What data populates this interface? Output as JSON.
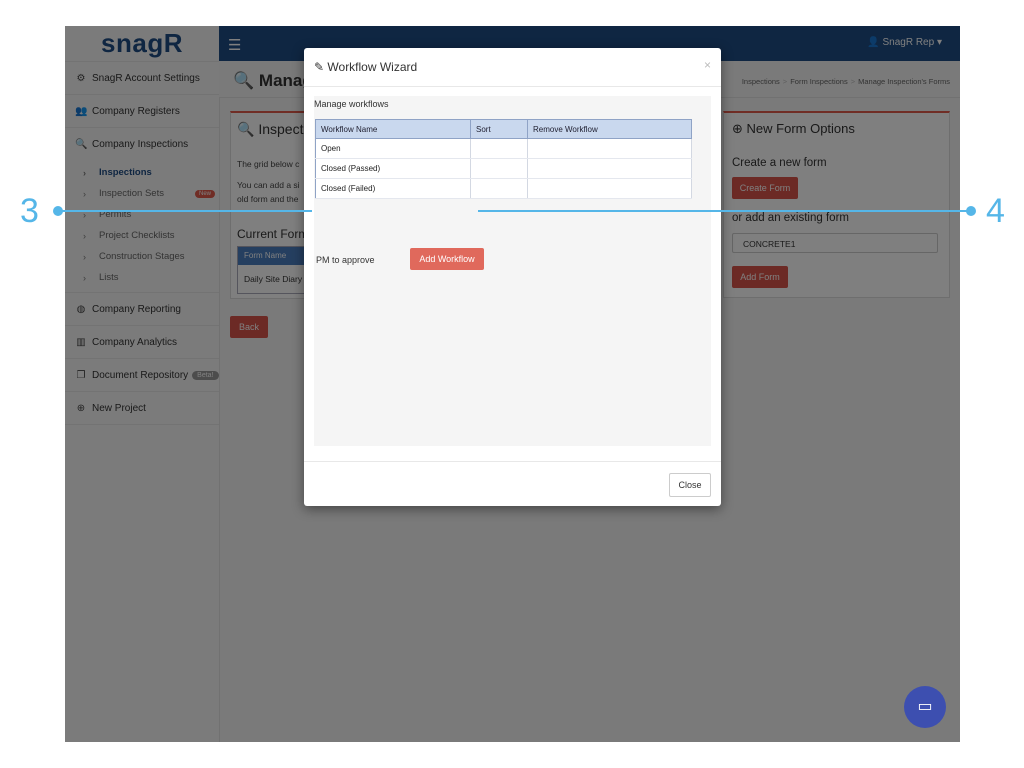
{
  "logo": "snagR",
  "sidebar": {
    "items": [
      {
        "label": "SnagR Account Settings",
        "icon": "gears-icon"
      },
      {
        "label": "Company Registers",
        "icon": "users-icon"
      },
      {
        "label": "Company Inspections",
        "icon": "search-icon"
      },
      {
        "label": "Company Reporting",
        "icon": "globe-icon"
      },
      {
        "label": "Company Analytics",
        "icon": "bar-chart-icon"
      },
      {
        "label": "Document Repository",
        "icon": "copy-icon",
        "badge": "Beta!"
      },
      {
        "label": "New Project",
        "icon": "plus-circle-icon"
      }
    ],
    "sub_items": [
      {
        "label": "Inspections",
        "active": true
      },
      {
        "label": "Inspection Sets",
        "badge": "New"
      },
      {
        "label": "Permits"
      },
      {
        "label": "Project Checklists"
      },
      {
        "label": "Construction Stages"
      },
      {
        "label": "Lists"
      }
    ]
  },
  "topbar": {
    "user": "SnagR Rep"
  },
  "page": {
    "title": "Manage",
    "breadcrumb": [
      "Inspections",
      "Form Inspections",
      "Manage Inspection's Forms"
    ],
    "left_panel": {
      "title": "Inspectio",
      "text1": "The grid below c",
      "text2": "You can add a si",
      "text3": "old form and the",
      "current_forms": "Current Form",
      "table_header": "Form Name",
      "table_row": "Daily Site Diary"
    },
    "back_label": "Back",
    "right_panel": {
      "title": "New Form Options",
      "create_text": "Create a new form",
      "create_btn": "Create Form",
      "existing_text": "or add an existing form",
      "select_value": "CONCRETE1",
      "add_btn": "Add Form"
    }
  },
  "modal": {
    "title": "Workflow Wizard",
    "close_x": "×",
    "manage_label": "Manage workflows",
    "columns": [
      "Workflow Name",
      "Sort",
      "Remove Workflow"
    ],
    "rows": [
      {
        "name": "Open"
      },
      {
        "name": "Closed (Passed)"
      },
      {
        "name": "Closed (Failed)"
      }
    ],
    "input_value": "PM to approve",
    "add_btn": "Add Workflow",
    "close_btn": "Close"
  },
  "callouts": [
    "3",
    "4"
  ],
  "colors": {
    "brand": "#1f4c84",
    "accent": "#e0695c",
    "callout": "#55b6e8"
  }
}
